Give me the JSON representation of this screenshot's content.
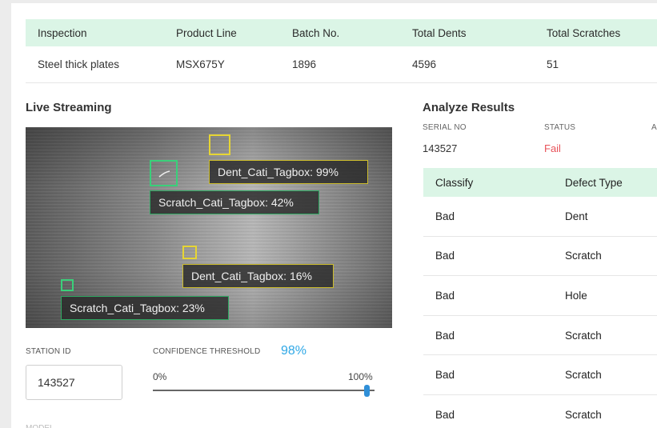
{
  "summary": {
    "headers": [
      "Inspection",
      "Product Line",
      "Batch No.",
      "Total Dents",
      "Total Scratches"
    ],
    "row": [
      "Steel thick plates",
      "MSX675Y",
      "1896",
      "4596",
      "51"
    ]
  },
  "live": {
    "title": "Live Streaming",
    "detections": [
      {
        "label": "Dent_Cati_Tagbox: 99%",
        "color": "yellow"
      },
      {
        "label": "Scratch_Cati_Tagbox: 42%",
        "color": "green"
      },
      {
        "label": "Dent_Cati_Tagbox: 16%",
        "color": "yellow"
      },
      {
        "label": "Scratch_Cati_Tagbox: 23%",
        "color": "green"
      }
    ]
  },
  "station": {
    "label": "STATION ID",
    "value": "143527"
  },
  "confidence": {
    "label": "CONFIDENCE THRESHOLD",
    "value": "98%",
    "level": 0.98,
    "min_label": "0%",
    "max_label": "100%"
  },
  "analyze": {
    "title": "Analyze Results",
    "serial_label": "SERIAL NO",
    "serial_value": "143527",
    "status_label": "STATUS",
    "status_value": "Fail",
    "status_color": "#e8535a",
    "third_label": "A",
    "headers": [
      "Classify",
      "Defect Type"
    ],
    "rows": [
      [
        "Bad",
        "Dent"
      ],
      [
        "Bad",
        "Scratch"
      ],
      [
        "Bad",
        "Hole"
      ],
      [
        "Bad",
        "Scratch"
      ],
      [
        "Bad",
        "Scratch"
      ],
      [
        "Bad",
        "Scratch"
      ]
    ]
  },
  "colors": {
    "header_bg": "#dbf5e6",
    "accent_blue": "#2fa8e6",
    "box_yellow": "#e6d534",
    "box_green": "#3ad07a"
  }
}
